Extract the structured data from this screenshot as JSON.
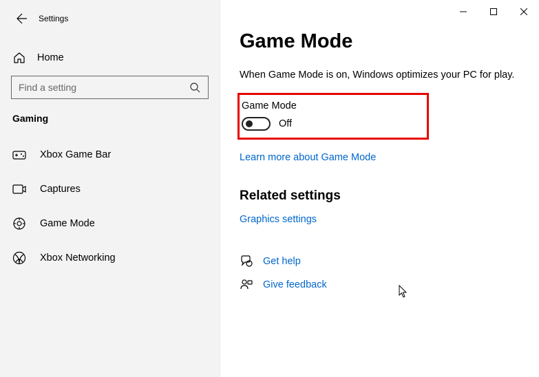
{
  "window": {
    "title": "Settings"
  },
  "sidebar": {
    "home": "Home",
    "search_placeholder": "Find a setting",
    "category": "Gaming",
    "items": [
      {
        "label": "Xbox Game Bar"
      },
      {
        "label": "Captures"
      },
      {
        "label": "Game Mode"
      },
      {
        "label": "Xbox Networking"
      }
    ]
  },
  "main": {
    "title": "Game Mode",
    "description": "When Game Mode is on, Windows optimizes your PC for play.",
    "toggle": {
      "label": "Game Mode",
      "state": "Off"
    },
    "learn_more": "Learn more about Game Mode",
    "related_title": "Related settings",
    "graphics_link": "Graphics settings",
    "get_help": "Get help",
    "give_feedback": "Give feedback"
  }
}
